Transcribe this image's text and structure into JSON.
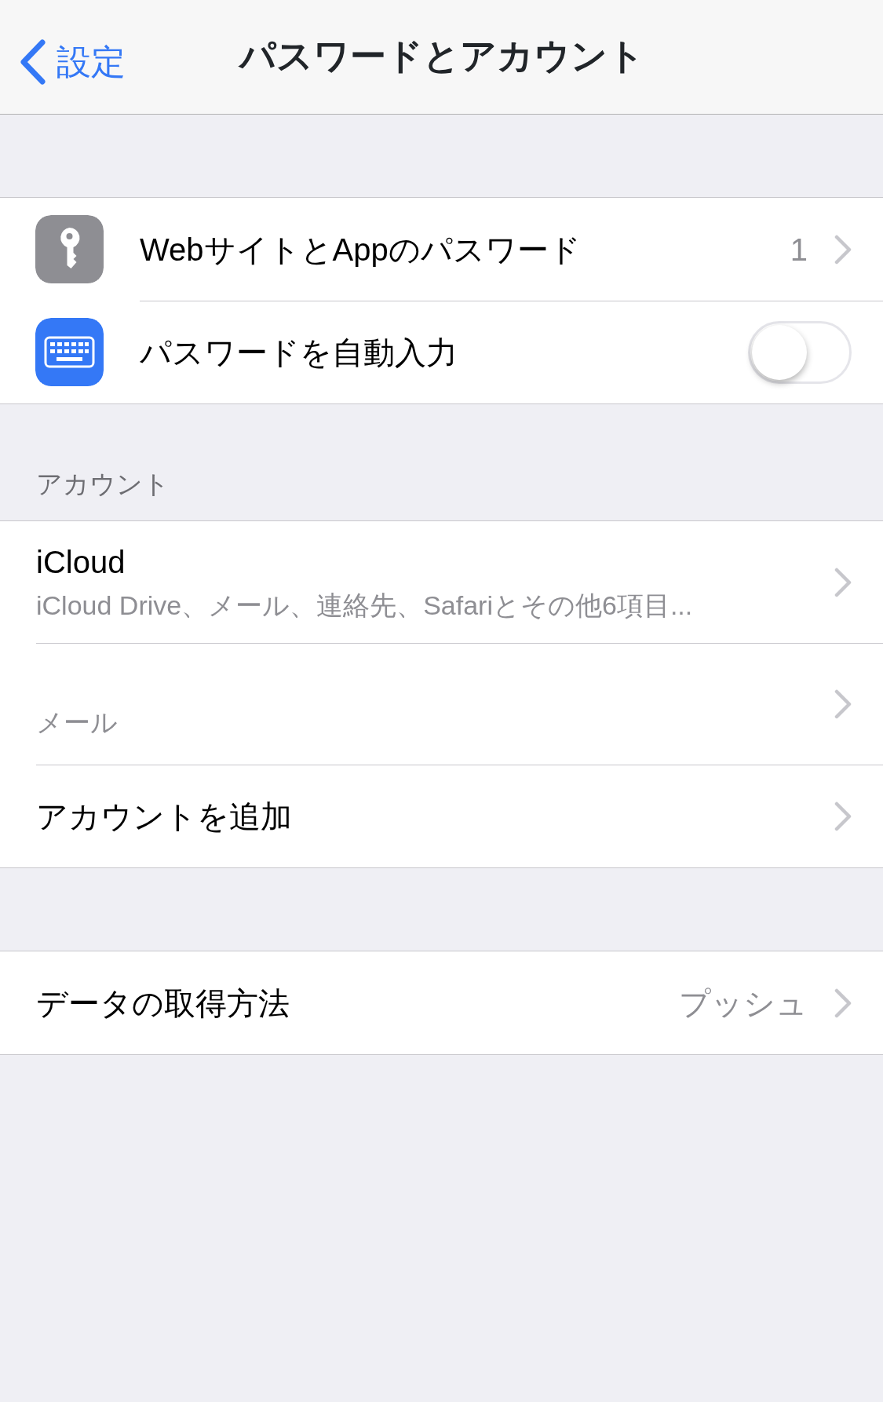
{
  "nav": {
    "back": "設定",
    "title": "パスワードとアカウント"
  },
  "sections": [
    {
      "rows": [
        {
          "kind": "passwords",
          "title": "WebサイトとAppのパスワード",
          "value": "1"
        },
        {
          "kind": "autofill",
          "title": "パスワードを自動入力",
          "on": false
        }
      ]
    },
    {
      "header": "アカウント",
      "rows": [
        {
          "kind": "account",
          "title": "iCloud",
          "subtitle": "iCloud Drive、メール、連絡先、Safariとその他6項目..."
        },
        {
          "kind": "account",
          "subtitle": "メール"
        },
        {
          "kind": "link",
          "title": "アカウントを追加"
        }
      ]
    },
    {
      "rows": [
        {
          "kind": "link",
          "title": "データの取得方法",
          "value": "プッシュ"
        }
      ]
    }
  ]
}
